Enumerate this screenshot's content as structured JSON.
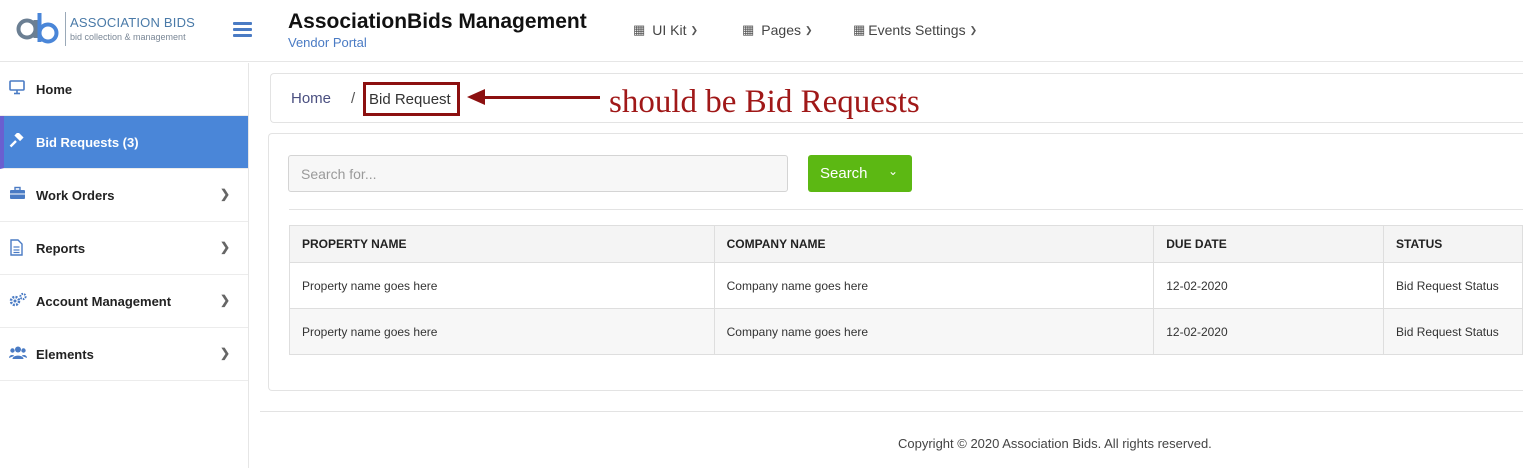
{
  "brand": {
    "logo_mark": "ab",
    "logo_name": "ASSOCIATION BIDS",
    "logo_tagline": "bid collection & management",
    "accent": "#4a7bc4"
  },
  "header": {
    "title": "AssociationBids Management",
    "subtitle": "Vendor Portal",
    "menu": [
      {
        "label": "UI Kit",
        "icon": "grid-icon"
      },
      {
        "label": "Pages",
        "icon": "grid-icon"
      },
      {
        "label": "Events Settings",
        "icon": "calendar-icon"
      }
    ]
  },
  "sidebar": {
    "items": [
      {
        "label": "Home",
        "icon": "monitor-icon",
        "active": false,
        "has_children": false
      },
      {
        "label": "Bid Requests (3)",
        "icon": "gavel-icon",
        "active": true,
        "has_children": false
      },
      {
        "label": "Work Orders",
        "icon": "briefcase-icon",
        "active": false,
        "has_children": true
      },
      {
        "label": "Reports",
        "icon": "document-icon",
        "active": false,
        "has_children": true
      },
      {
        "label": "Account Management",
        "icon": "cogs-icon",
        "active": false,
        "has_children": true
      },
      {
        "label": "Elements",
        "icon": "users-icon",
        "active": false,
        "has_children": true
      }
    ],
    "active_color": "#4a86d8"
  },
  "breadcrumb": {
    "home": "Home",
    "separator": "/",
    "current": "Bid Request"
  },
  "annotation": {
    "text": "should be Bid Requests",
    "color": "#a01818"
  },
  "search": {
    "placeholder": "Search for...",
    "button_label": "Search",
    "button_color": "#5cb813"
  },
  "table": {
    "columns": [
      "PROPERTY NAME",
      "COMPANY NAME",
      "DUE DATE",
      "STATUS"
    ],
    "rows": [
      [
        "Property name goes here",
        "Company name goes here",
        "12-02-2020",
        "Bid Request Status"
      ],
      [
        "Property name goes here",
        "Company name goes here",
        "12-02-2020",
        "Bid Request Status"
      ]
    ]
  },
  "footer": {
    "text": "Copyright © 2020 Association Bids. All rights reserved."
  }
}
